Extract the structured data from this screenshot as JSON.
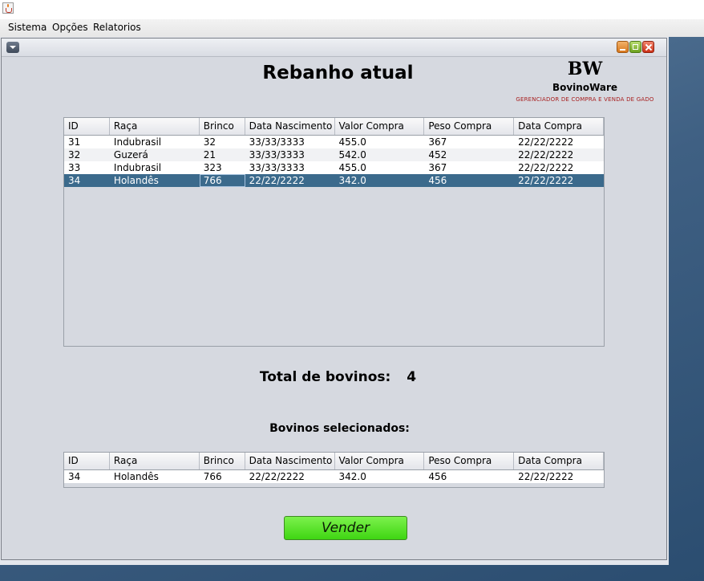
{
  "menubar": {
    "items": [
      "Sistema",
      "Opções",
      "Relatorios"
    ]
  },
  "window": {
    "icons": {
      "system_menu": "chevron-down-icon",
      "minimize": "minimize-icon",
      "maximize": "maximize-icon",
      "close": "close-icon"
    },
    "title": "Rebanho atual"
  },
  "logo": {
    "mark": "BW",
    "name": "BovinoWare",
    "tagline": "GERENCIADOR DE COMPRA E VENDA DE GADO"
  },
  "herd_table": {
    "columns": [
      "ID",
      "Raça",
      "Brinco",
      "Data Nascimento",
      "Valor Compra",
      "Peso Compra",
      "Data Compra"
    ],
    "rows": [
      [
        "31",
        "Indubrasil",
        "32",
        "33/33/3333",
        "455.0",
        "367",
        "22/22/2222"
      ],
      [
        "32",
        "Guzerá",
        "21",
        "33/33/3333",
        "542.0",
        "452",
        "22/22/2222"
      ],
      [
        "33",
        "Indubrasil",
        "323",
        "33/33/3333",
        "455.0",
        "367",
        "22/22/2222"
      ],
      [
        "34",
        "Holandês",
        "766",
        "22/22/2222",
        "342.0",
        "456",
        "22/22/2222"
      ]
    ],
    "selected_row": 3
  },
  "total": {
    "label": "Total de bovinos:",
    "value": "4"
  },
  "selected_label": "Bovinos selecionados:",
  "selected_table": {
    "columns": [
      "ID",
      "Raça",
      "Brinco",
      "Data Nascimento",
      "Valor Compra",
      "Peso Compra",
      "Data Compra"
    ],
    "rows": [
      [
        "34",
        "Holandês",
        "766",
        "22/22/2222",
        "342.0",
        "456",
        "22/22/2222"
      ]
    ]
  },
  "actions": {
    "sell_label": "Vender"
  },
  "colors": {
    "selection": "#3b6a8c",
    "sell_button": "#4fe022",
    "logo_tagline": "#a82020"
  }
}
